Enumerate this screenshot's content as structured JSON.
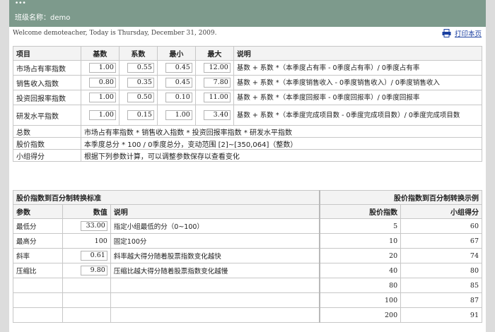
{
  "header": {
    "title": "...",
    "class_label": "班级名称：demo"
  },
  "welcome": {
    "text": "Welcome demoteacher, Today is Thursday, December 31, 2009.",
    "print_label": "打印本页"
  },
  "params_table": {
    "headers": [
      "项目",
      "基数",
      "系数",
      "最小",
      "最大",
      "说明"
    ],
    "rows": [
      {
        "name": "市场占有率指数",
        "base": "1.00",
        "coef": "0.55",
        "min": "0.45",
        "max": "12.00",
        "desc": "基数 + 系数 *（本季度占有率 - 0季度占有率）/ 0季度占有率"
      },
      {
        "name": "销售收入指数",
        "base": "0.80",
        "coef": "0.35",
        "min": "0.45",
        "max": "7.80",
        "desc": "基数 + 系数 *（本季度销售收入 - 0季度销售收入）/ 0季度销售收入"
      },
      {
        "name": "投资回报率指数",
        "base": "1.00",
        "coef": "0.50",
        "min": "0.10",
        "max": "11.00",
        "desc": "基数 + 系数 *（本季度回报率 - 0季度回报率）/ 0季度回报率"
      },
      {
        "name": "研发水平指数",
        "base": "1.00",
        "coef": "0.15",
        "min": "1.00",
        "max": "3.40",
        "desc": "基数 + 系数 *（本季度完成项目数 - 0季度完成项目数）/ 0季度完成项目数"
      }
    ],
    "summary": [
      {
        "name": "总数",
        "desc": "市场占有率指数 * 销售收入指数 * 投资回报率指数 * 研发水平指数"
      },
      {
        "name": "股价指数",
        "desc": "本季度总分 * 100 / 0季度总分，变动范围 [2]~[350,064]（整数）"
      },
      {
        "name": "小组得分",
        "desc": "根据下列参数计算，可以调整参数保存以查看变化"
      }
    ]
  },
  "conversion": {
    "left_title": "股价指数到百分制转换标准",
    "right_title": "股价指数到百分制转换示例",
    "headers": [
      "参数",
      "数值",
      "说明",
      "股价指数",
      "小组得分"
    ],
    "params": [
      {
        "name": "最低分",
        "value": "33.00",
        "desc": "指定小组最低的分（0~100）",
        "boxed": true
      },
      {
        "name": "最高分",
        "value": "100",
        "desc": "固定100分",
        "boxed": false
      },
      {
        "name": "斜率",
        "value": "0.61",
        "desc": "斜率越大得分随着股票指数变化越快",
        "boxed": true
      },
      {
        "name": "压缩比",
        "value": "9.80",
        "desc": "压缩比越大得分随着股票指数变化越慢",
        "boxed": true
      }
    ],
    "examples": [
      {
        "index": "5",
        "score": "60"
      },
      {
        "index": "10",
        "score": "67"
      },
      {
        "index": "20",
        "score": "74"
      },
      {
        "index": "40",
        "score": "80"
      },
      {
        "index": "80",
        "score": "85"
      },
      {
        "index": "100",
        "score": "87"
      },
      {
        "index": "200",
        "score": "91"
      }
    ]
  }
}
